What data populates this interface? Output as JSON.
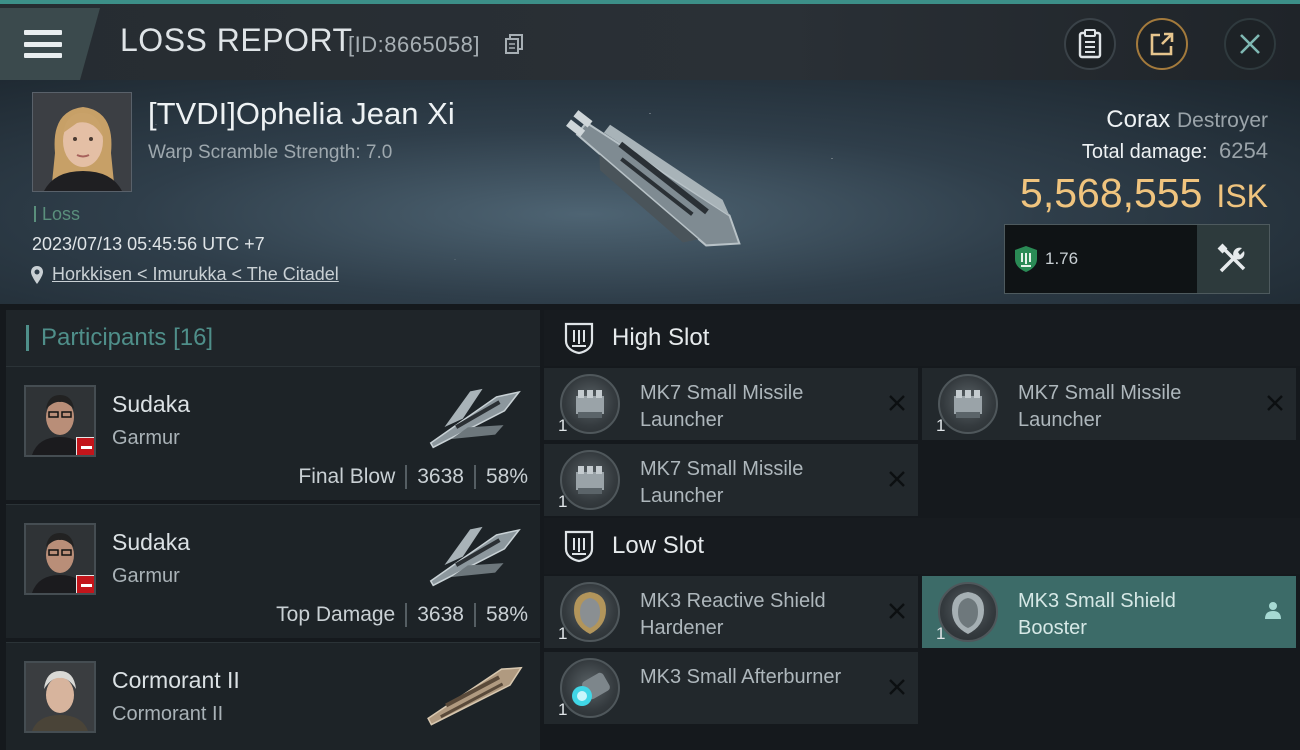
{
  "header": {
    "title": "LOSS REPORT",
    "report_id": "[ID:8665058]"
  },
  "victim": {
    "pilot_name": "[TVDI]Ophelia Jean Xi",
    "warp_scramble": "Warp Scramble Strength: 7.0",
    "tag": "Loss",
    "datetime": "2023/07/13 05:45:56 UTC +7",
    "location": "Horkkisen < Imurukka < The Citadel",
    "ship_name": "Corax",
    "ship_class": "Destroyer",
    "total_damage_label": "Total damage:",
    "total_damage_value": "6254",
    "isk_value": "5,568,555",
    "isk_unit": "ISK",
    "fit_score": "1.76"
  },
  "participants": {
    "title": "Participants",
    "count": "[16]",
    "items": [
      {
        "name": "Sudaka",
        "ship": "Garmur",
        "role": "Final Blow",
        "damage": "3638",
        "percent": "58%"
      },
      {
        "name": "Sudaka",
        "ship": "Garmur",
        "role": "Top Damage",
        "damage": "3638",
        "percent": "58%"
      },
      {
        "name": "Cormorant II",
        "ship": "Cormorant II",
        "role": "",
        "damage": "",
        "percent": ""
      }
    ]
  },
  "fitting": {
    "high_slot_label": "High Slot",
    "low_slot_label": "Low Slot",
    "high_modules": [
      {
        "name": "MK7 Small Missile Launcher",
        "qty": "1"
      },
      {
        "name": "MK7 Small Missile Launcher",
        "qty": "1"
      },
      {
        "name": "MK7 Small Missile Launcher",
        "qty": "1"
      }
    ],
    "low_modules": [
      {
        "name": "MK3 Reactive Shield Hardener",
        "qty": "1"
      },
      {
        "name": "MK3 Small Shield Booster",
        "qty": "1"
      },
      {
        "name": "MK3 Small Afterburner",
        "qty": "1"
      }
    ]
  },
  "colors": {
    "accent": "#3c8f88",
    "isk": "#f0c47e",
    "loss_flag": "#c3151b",
    "active_module": "#3c6b68"
  }
}
